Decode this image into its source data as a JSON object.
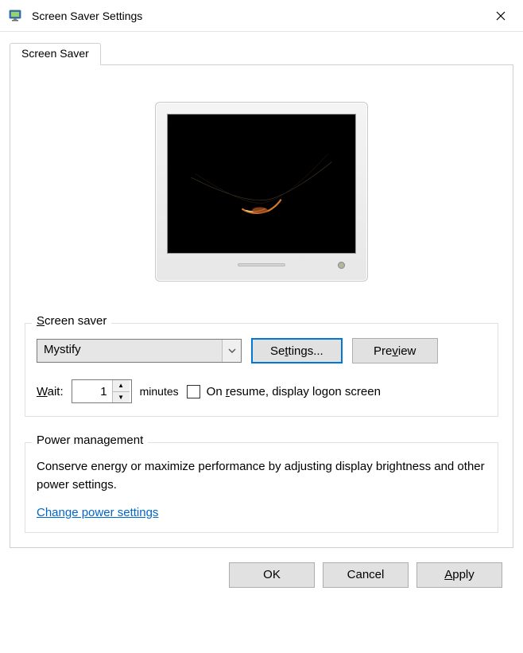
{
  "window": {
    "title": "Screen Saver Settings"
  },
  "tab": {
    "label": "Screen Saver"
  },
  "screensaver": {
    "group_label": "Screen saver",
    "dropdown_value": "Mystify",
    "settings_button": "Settings...",
    "preview_button": "Preview",
    "wait_label_pre": "W",
    "wait_label_post": "ait:",
    "wait_value": "1",
    "minutes_label": "minutes",
    "resume_label_pre": "On ",
    "resume_label_u": "r",
    "resume_label_post": "esume, display logon screen"
  },
  "power": {
    "group_label": "Power management",
    "description": "Conserve energy or maximize performance by adjusting display brightness and other power settings.",
    "link_text": "Change power settings"
  },
  "buttons": {
    "ok": "OK",
    "cancel": "Cancel",
    "apply": "Apply"
  }
}
